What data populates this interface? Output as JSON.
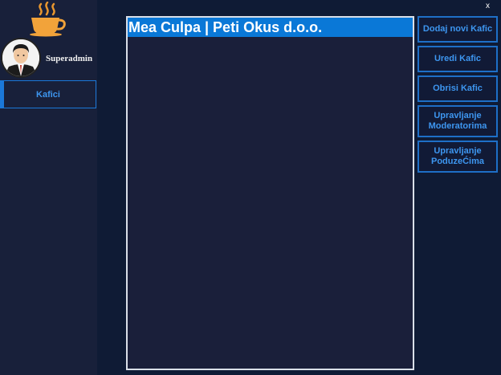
{
  "sidebar": {
    "logo_icon": "coffee-cup-icon",
    "user": {
      "avatar_icon": "user-avatar-icon",
      "name": "Superadmin"
    },
    "nav": [
      {
        "label": "Kafici",
        "active": true
      }
    ]
  },
  "window": {
    "close_label": "x"
  },
  "list": {
    "items": [
      "Mea Culpa | Peti Okus d.o.o."
    ]
  },
  "actions": [
    "Dodaj novi Kafic",
    "Uredi Kafic",
    "Obrisi Kafic",
    "Upravljanje\nModeratorima",
    "Upravljanje\nPoduzeĆima"
  ],
  "colors": {
    "accent": "#1b78d8",
    "selected_row": "#0a78d7",
    "sidebar_bg": "#18203a",
    "window_bg": "#0f1b35"
  }
}
